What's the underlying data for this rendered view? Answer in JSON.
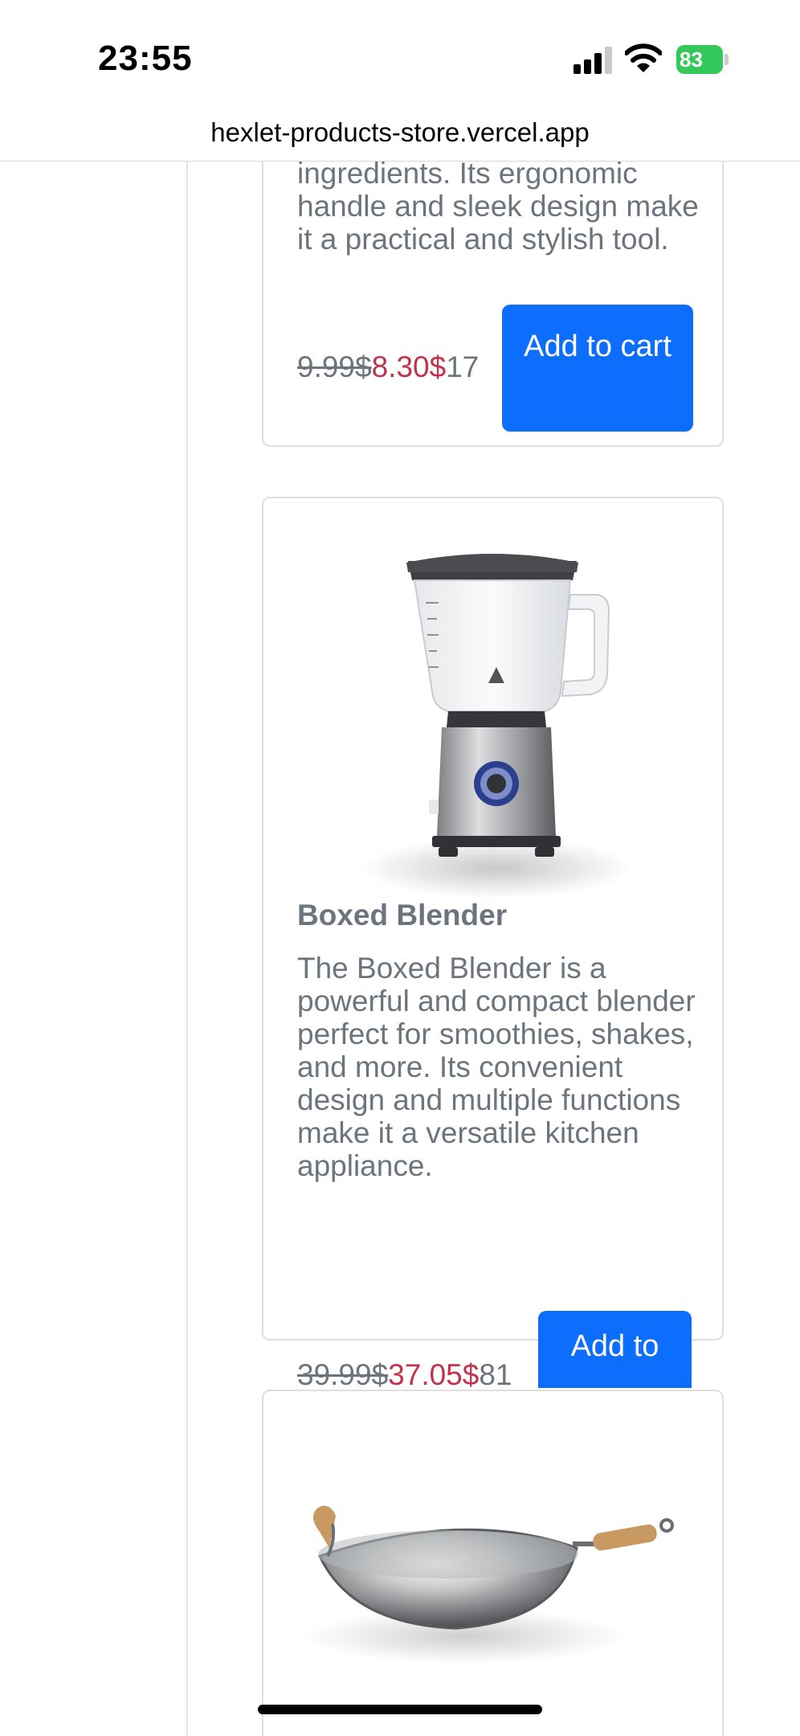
{
  "status_bar": {
    "time": "23:55",
    "battery": "83",
    "colors": {
      "battery": "#34c759"
    },
    "icons": [
      "cellular-signal-icon",
      "wifi-icon",
      "battery-charging-icon"
    ]
  },
  "browser": {
    "url": "hexlet-products-store.vercel.app"
  },
  "products": [
    {
      "description_visible": "ingredients. Its ergonomic handle and sleek design make it a practical and stylish tool.",
      "old_price": "9.99$",
      "new_price": "8.30$",
      "discount": "17",
      "add_to_cart": "Add to cart"
    },
    {
      "image": "blender-image",
      "name": "Boxed Blender",
      "description": "The Boxed Blender is a powerful and compact blender perfect for smoothies, shakes, and more. Its convenient design and multiple functions make it a versatile kitchen appliance.",
      "old_price": "39.99$",
      "new_price": "37.05$",
      "discount": "81",
      "add_to_cart": "Add to"
    },
    {
      "image": "wok-pan-image"
    }
  ],
  "colors": {
    "button": "#0d6efd",
    "sale_price": "#c1334b",
    "muted_text": "#6c757d",
    "card_border": "#dfdfdf"
  }
}
